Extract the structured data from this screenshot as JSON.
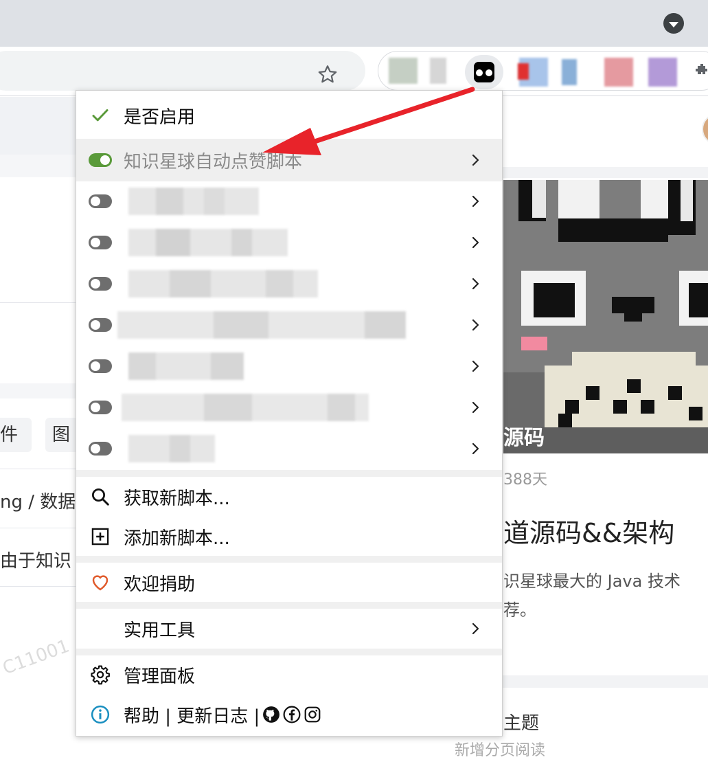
{
  "menu": {
    "enable_label": "是否启用",
    "active_script": "知识星球自动点赞脚本",
    "get_new": "获取新脚本...",
    "add_new": "添加新脚本...",
    "donate": "欢迎捐助",
    "utilities": "实用工具",
    "dashboard": "管理面板",
    "help_line": "帮助 | 更新日志 |"
  },
  "page": {
    "tab_a": "件",
    "tab_b": "图",
    "crumb": "ng / 数据库",
    "snippet": "由于知识",
    "watermark": "C11001",
    "cover_label": "源码",
    "days": "388天",
    "title": "道源码&&架构",
    "desc1": "识星球最大的 Java 技术",
    "desc2": "荐。",
    "topic": "主题",
    "topic_sub": "新增分页阅读"
  },
  "colors": {
    "accent_green": "#5a9a3a",
    "arrow_red": "#e8232a",
    "heart_red": "#e05a2b",
    "info_blue": "#1a8fc0"
  }
}
